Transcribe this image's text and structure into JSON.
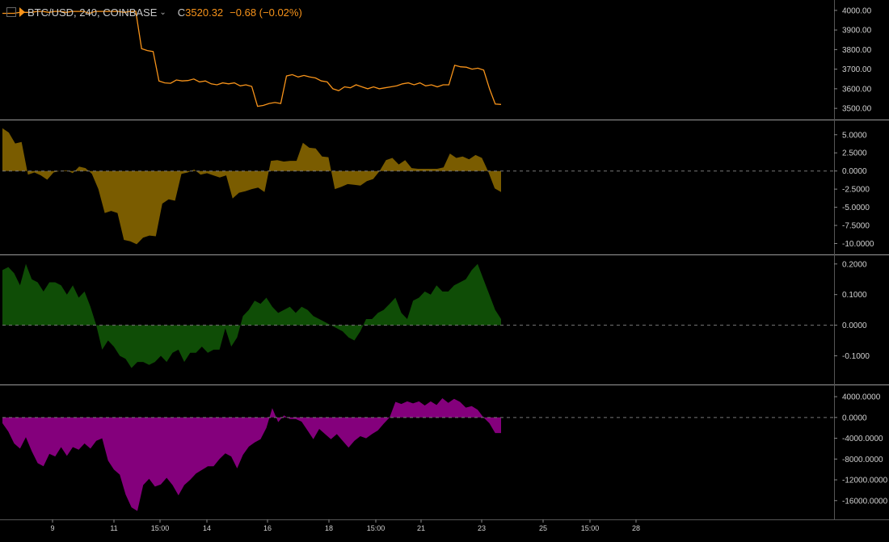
{
  "header": {
    "symbol": "BTC/USD, 240, COINBASE",
    "close_prefix": "C",
    "close_value": "3520.32",
    "change": "−0.68 (−0.02%)"
  },
  "colors": {
    "price": "#f7931a",
    "ind1": "#7a5c00",
    "ind2": "#0f4d06",
    "ind3": "#84007c",
    "background": "#000000",
    "separator": "#9a9a9a",
    "axis_text": "#d0d0d0",
    "zero_line": "#777777"
  },
  "x_axis": {
    "labels": [
      "9",
      "11",
      "15:00",
      "14",
      "16",
      "18",
      "15:00",
      "21",
      "23",
      "25",
      "15:00",
      "28"
    ]
  },
  "chart_data": [
    {
      "type": "line",
      "title": "",
      "ylim": [
        3480,
        4020
      ],
      "yticks": [
        "4000.00",
        "3900.00",
        "3800.00",
        "3700.00",
        "3600.00",
        "3500.00"
      ],
      "yvals": [
        4000,
        3900,
        3800,
        3700,
        3600,
        3500
      ],
      "series": [
        {
          "values": [
            3985,
            3985,
            3985,
            3990,
            3990,
            3990,
            3995,
            3995,
            3990,
            3995,
            3995,
            3990,
            3995,
            3995,
            3995,
            3985,
            3995,
            3995,
            3995,
            3995,
            3995,
            3990,
            3995,
            3995,
            3805,
            3795,
            3790,
            3640,
            3630,
            3628,
            3645,
            3640,
            3642,
            3650,
            3635,
            3640,
            3625,
            3620,
            3630,
            3625,
            3630,
            3615,
            3620,
            3612,
            3510,
            3515,
            3525,
            3530,
            3525,
            3665,
            3672,
            3660,
            3668,
            3660,
            3655,
            3640,
            3635,
            3600,
            3590,
            3610,
            3605,
            3620,
            3610,
            3600,
            3610,
            3600,
            3605,
            3610,
            3615,
            3625,
            3630,
            3620,
            3630,
            3615,
            3620,
            3610,
            3620,
            3620,
            3720,
            3712,
            3710,
            3700,
            3705,
            3695,
            3600,
            3522,
            3520
          ]
        }
      ]
    },
    {
      "type": "area",
      "title": "",
      "ylim": [
        -10.5,
        6.2
      ],
      "yticks": [
        "5.0000",
        "2.5000",
        "0.0000",
        "-2.5000",
        "-5.0000",
        "-7.5000",
        "-10.0000"
      ],
      "yvals": [
        5,
        2.5,
        0,
        -2.5,
        -5,
        -7.5,
        -10
      ],
      "series": [
        {
          "values": [
            5.9,
            5.3,
            3.8,
            4.0,
            -0.5,
            -0.2,
            -0.6,
            -1.2,
            -0.2,
            0.0,
            0.1,
            -0.3,
            0.6,
            0.4,
            -0.4,
            -2.5,
            -5.8,
            -5.5,
            -5.8,
            -9.5,
            -9.7,
            -10.1,
            -9.2,
            -8.9,
            -9.0,
            -4.5,
            -3.9,
            -4.1,
            -0.4,
            -0.2,
            0.2,
            -0.5,
            -0.3,
            -0.6,
            -0.9,
            -0.6,
            -3.8,
            -3.0,
            -2.8,
            -2.5,
            -2.3,
            -2.9,
            1.4,
            1.5,
            1.3,
            1.4,
            1.4,
            3.9,
            3.2,
            3.1,
            2.0,
            1.9,
            -2.5,
            -2.2,
            -1.8,
            -1.9,
            -2.0,
            -1.4,
            -1.1,
            0.0,
            1.5,
            1.8,
            0.9,
            1.5,
            0.4,
            0.3,
            0.3,
            0.3,
            0.3,
            0.5,
            2.4,
            1.8,
            2.0,
            1.6,
            2.2,
            1.8,
            -0.1,
            -2.4,
            -2.9
          ]
        }
      ]
    },
    {
      "type": "area",
      "title": "",
      "ylim": [
        -0.17,
        0.21
      ],
      "yticks": [
        "0.2000",
        "0.1000",
        "0.0000",
        "-0.1000"
      ],
      "yvals": [
        0.2,
        0.1,
        0,
        -0.1
      ],
      "series": [
        {
          "values": [
            0.18,
            0.19,
            0.17,
            0.13,
            0.2,
            0.15,
            0.14,
            0.11,
            0.14,
            0.14,
            0.13,
            0.1,
            0.13,
            0.09,
            0.11,
            0.06,
            0.0,
            -0.08,
            -0.05,
            -0.07,
            -0.1,
            -0.11,
            -0.14,
            -0.12,
            -0.12,
            -0.13,
            -0.12,
            -0.1,
            -0.12,
            -0.09,
            -0.08,
            -0.12,
            -0.09,
            -0.09,
            -0.07,
            -0.09,
            -0.08,
            -0.08,
            -0.01,
            -0.07,
            -0.04,
            0.03,
            0.05,
            0.08,
            0.07,
            0.09,
            0.06,
            0.04,
            0.05,
            0.06,
            0.04,
            0.06,
            0.05,
            0.03,
            0.02,
            0.01,
            0.0,
            -0.01,
            -0.02,
            -0.04,
            -0.05,
            -0.02,
            0.02,
            0.02,
            0.04,
            0.05,
            0.07,
            0.09,
            0.04,
            0.02,
            0.08,
            0.09,
            0.11,
            0.1,
            0.13,
            0.11,
            0.11,
            0.13,
            0.14,
            0.15,
            0.18,
            0.2,
            0.15,
            0.1,
            0.05,
            0.02
          ]
        }
      ]
    },
    {
      "type": "area",
      "title": "",
      "ylim": [
        -17900,
        5100
      ],
      "yticks": [
        "4000.0000",
        "0.0000",
        "-4000.0000",
        "-8000.0000",
        "-12000.0000",
        "-16000.0000"
      ],
      "yvals": [
        4000,
        0,
        -4000,
        -8000,
        -12000,
        -16000
      ],
      "series": [
        {
          "values": [
            -1100,
            -2700,
            -5000,
            -6000,
            -3800,
            -6500,
            -8800,
            -9400,
            -7000,
            -7500,
            -5700,
            -7400,
            -5700,
            -6200,
            -5000,
            -6000,
            -4500,
            -4000,
            -8300,
            -10000,
            -11000,
            -14800,
            -17300,
            -18000,
            -13000,
            -11800,
            -13300,
            -12900,
            -11600,
            -13000,
            -15000,
            -13000,
            -12000,
            -10800,
            -10100,
            -9400,
            -9400,
            -8000,
            -6900,
            -7500,
            -9800,
            -7200,
            -5600,
            -4800,
            -4200,
            -2000,
            1800,
            -900,
            400,
            -300,
            -300,
            -800,
            -2500,
            -4200,
            -2200,
            -3200,
            -4200,
            -3200,
            -4500,
            -5800,
            -4500,
            -3600,
            -4000,
            -3200,
            -2500,
            -1200,
            0,
            3000,
            2600,
            3100,
            2700,
            3100,
            2300,
            3100,
            2400,
            3700,
            2800,
            3600,
            3000,
            1900,
            2200,
            1500,
            0,
            -1100,
            -3000,
            -3000
          ]
        }
      ]
    }
  ]
}
